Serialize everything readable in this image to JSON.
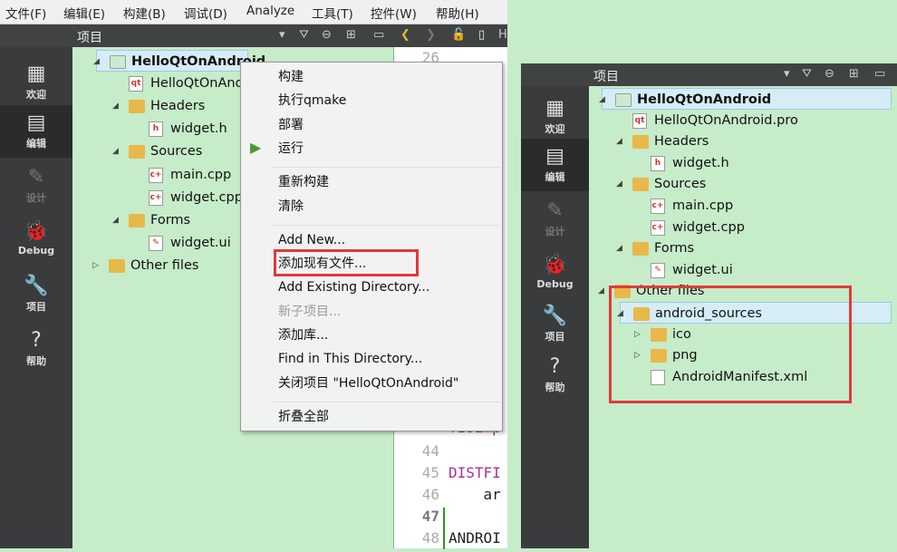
{
  "left": {
    "menubar": [
      "文件(F)",
      "编辑(E)",
      "构建(B)",
      "调试(D)",
      "Analyze",
      "工具(T)",
      "控件(W)",
      "帮助(H)"
    ],
    "panel_title": "项目",
    "editor_tab_text": "H",
    "sidebar": [
      {
        "label": "欢迎",
        "icon": "grid-icon"
      },
      {
        "label": "编辑",
        "icon": "edit-icon",
        "active": true
      },
      {
        "label": "设计",
        "icon": "pencil-icon",
        "disabled": true
      },
      {
        "label": "Debug",
        "icon": "bug-icon"
      },
      {
        "label": "项目",
        "icon": "wrench-icon"
      },
      {
        "label": "帮助",
        "icon": "help-icon"
      }
    ],
    "tree": [
      {
        "label": "HelloQtOnAndroid",
        "level": 0,
        "arrow": "◢",
        "type": "project",
        "bold": true,
        "selected": true
      },
      {
        "label": "HelloQtOnAndroid.pro",
        "level": 1,
        "type": "pro"
      },
      {
        "label": "Headers",
        "level": 1,
        "arrow": "◢",
        "type": "folder-h"
      },
      {
        "label": "widget.h",
        "level": 2,
        "type": "h"
      },
      {
        "label": "Sources",
        "level": 1,
        "arrow": "◢",
        "type": "folder-cpp"
      },
      {
        "label": "main.cpp",
        "level": 2,
        "type": "cpp"
      },
      {
        "label": "widget.cpp",
        "level": 2,
        "type": "cpp"
      },
      {
        "label": "Forms",
        "level": 1,
        "arrow": "◢",
        "type": "folder-ui"
      },
      {
        "label": "widget.ui",
        "level": 2,
        "type": "ui"
      },
      {
        "label": "Other files",
        "level": 0,
        "arrow": "▷",
        "type": "folder-other"
      }
    ],
    "context_menu": [
      {
        "label": "构建"
      },
      {
        "label": "执行qmake"
      },
      {
        "label": "部署"
      },
      {
        "label": "运行",
        "icon": "run-icon"
      },
      {
        "separator": true
      },
      {
        "label": "重新构建"
      },
      {
        "label": "清除"
      },
      {
        "separator": true
      },
      {
        "label": "Add New..."
      },
      {
        "label": "添加现有文件...",
        "highlighted": true
      },
      {
        "label": "Add Existing Directory..."
      },
      {
        "label": "新子项目...",
        "disabled": true
      },
      {
        "label": "添加库..."
      },
      {
        "label": "Find in This Directory..."
      },
      {
        "label": "关闭项目 \"HelloQtOnAndroid\""
      },
      {
        "separator": true
      },
      {
        "label": "折叠全部"
      }
    ],
    "editor": {
      "line_numbers": [
        "26",
        "44",
        "45",
        "46",
        "47",
        "48"
      ],
      "code": {
        "45": "DISTFI",
        "46": "    ar",
        "48": "ANDROI",
        "43": "!ISEmp"
      }
    }
  },
  "right": {
    "panel_title": "项目",
    "sidebar": [
      {
        "label": "欢迎",
        "icon": "grid-icon"
      },
      {
        "label": "编辑",
        "icon": "edit-icon",
        "active": true
      },
      {
        "label": "设计",
        "icon": "pencil-icon",
        "disabled": true
      },
      {
        "label": "Debug",
        "icon": "bug-icon"
      },
      {
        "label": "项目",
        "icon": "wrench-icon"
      },
      {
        "label": "帮助",
        "icon": "help-icon"
      }
    ],
    "tree": [
      {
        "label": "HelloQtOnAndroid",
        "level": 0,
        "arrow": "◢",
        "type": "project",
        "bold": true,
        "selected": true
      },
      {
        "label": "HelloQtOnAndroid.pro",
        "level": 1,
        "type": "pro"
      },
      {
        "label": "Headers",
        "level": 1,
        "arrow": "◢",
        "type": "folder-h"
      },
      {
        "label": "widget.h",
        "level": 2,
        "type": "h"
      },
      {
        "label": "Sources",
        "level": 1,
        "arrow": "◢",
        "type": "folder-cpp"
      },
      {
        "label": "main.cpp",
        "level": 2,
        "type": "cpp"
      },
      {
        "label": "widget.cpp",
        "level": 2,
        "type": "cpp"
      },
      {
        "label": "Forms",
        "level": 1,
        "arrow": "◢",
        "type": "folder-ui"
      },
      {
        "label": "widget.ui",
        "level": 2,
        "type": "ui"
      },
      {
        "label": "Other files",
        "level": 0,
        "arrow": "◢",
        "type": "folder-other"
      },
      {
        "label": "android_sources",
        "level": 1,
        "arrow": "◢",
        "type": "folder",
        "selected": true
      },
      {
        "label": "ico",
        "level": 2,
        "arrow": "▷",
        "type": "folder"
      },
      {
        "label": "png",
        "level": 2,
        "arrow": "▷",
        "type": "folder"
      },
      {
        "label": "AndroidManifest.xml",
        "level": 2,
        "type": "file"
      }
    ]
  },
  "colors": {
    "highlight_box": "#e03a3a",
    "tree_bg": "#c6ecc9",
    "sidebar_bg": "#3a3b3d"
  }
}
